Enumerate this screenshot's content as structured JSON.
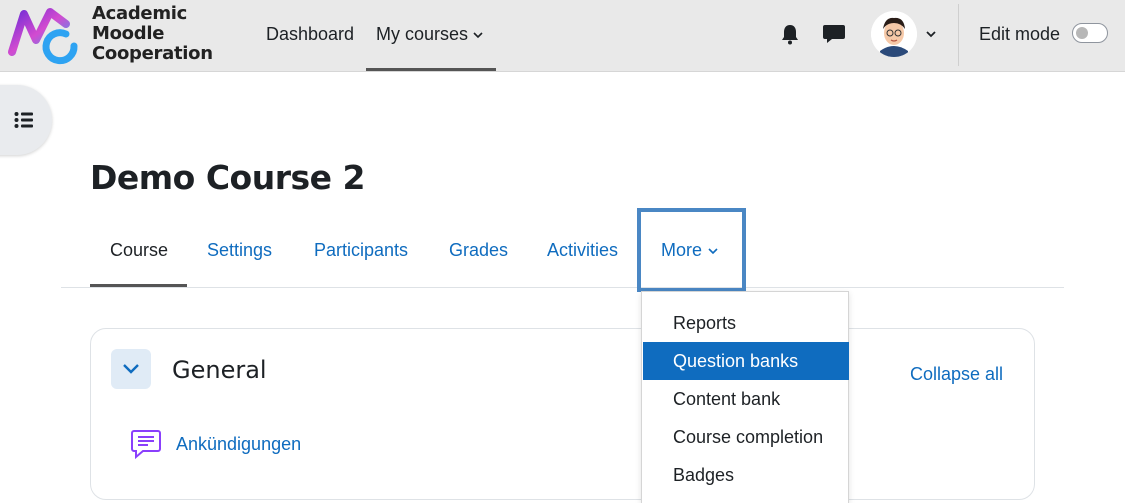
{
  "brand": {
    "line1": "Academic",
    "line2": "Moodle",
    "line3": "Cooperation",
    "logo_colors": [
      "#6f2bd6",
      "#d34bd0",
      "#2ea3f2"
    ]
  },
  "navbar": {
    "dashboard": "Dashboard",
    "my_courses": "My courses",
    "chevron": "⌄",
    "edit_mode": "Edit mode",
    "notification_icon": "bell-icon",
    "messages_icon": "chat-icon"
  },
  "course": {
    "title": "Demo Course 2"
  },
  "tabs": {
    "course": "Course",
    "settings": "Settings",
    "participants": "Participants",
    "grades": "Grades",
    "activities": "Activities",
    "more": "More"
  },
  "more_menu": {
    "items": [
      "Reports",
      "Question banks",
      "Content bank",
      "Course completion",
      "Badges"
    ],
    "active_item": "Question banks"
  },
  "section": {
    "title": "General",
    "collapse_all": "Collapse all",
    "activity": "Ankündigungen"
  },
  "colors": {
    "link": "#0f6cbf",
    "highlight_border": "#4a87c4",
    "menu_active_bg": "#0f6cbf",
    "forum_icon": "#8a3ffc"
  }
}
